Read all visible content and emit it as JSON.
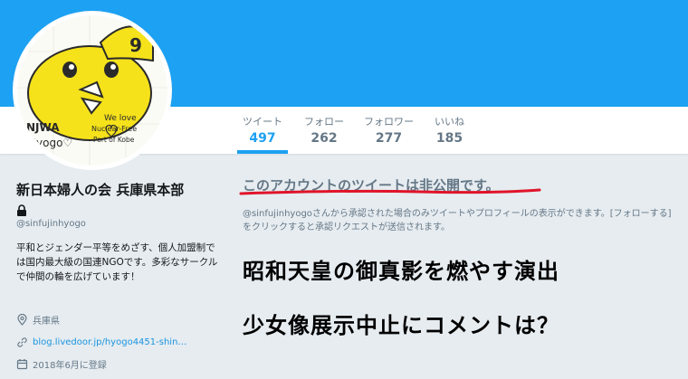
{
  "profile": {
    "name": "新日本婦人の会 兵庫県本部",
    "handle": "@sinfujinhyogo",
    "bio": "平和とジェンダー平等をめざす、個人加盟制では国内最大級の国連NGOです。多彩なサークルで仲間の輪を広げています！",
    "location": "兵庫県",
    "url": "blog.livedoor.jp/hyogo4451-shin…",
    "joined": "2018年6月に登録",
    "avatar_text": [
      "NJWA",
      "Hyogo♡",
      "We love",
      "Nuclear-Free",
      "Port of Kobe"
    ]
  },
  "stats": [
    {
      "label": "ツイート",
      "value": "497"
    },
    {
      "label": "フォロー",
      "value": "262"
    },
    {
      "label": "フォロワー",
      "value": "277"
    },
    {
      "label": "いいね",
      "value": "185"
    }
  ],
  "private_notice": {
    "title": "このアカウントのツイートは非公開です。",
    "description": "@sinfujinhyogoさんから承認された場合のみツイートやプロフィールの表示ができます。[フォローする] をクリックすると承認リクエストが送信されます。"
  },
  "overlay": {
    "line1": "昭和天皇の御真影を燃やす演出",
    "line2": "少女像展示中止にコメントは？"
  },
  "colors": {
    "banner": "#1da1f2",
    "accent": "#1da1f2",
    "underline": "#e0142a",
    "background": "#e6ecf0"
  },
  "icons": [
    "lock-icon",
    "location-icon",
    "link-icon",
    "calendar-icon"
  ]
}
